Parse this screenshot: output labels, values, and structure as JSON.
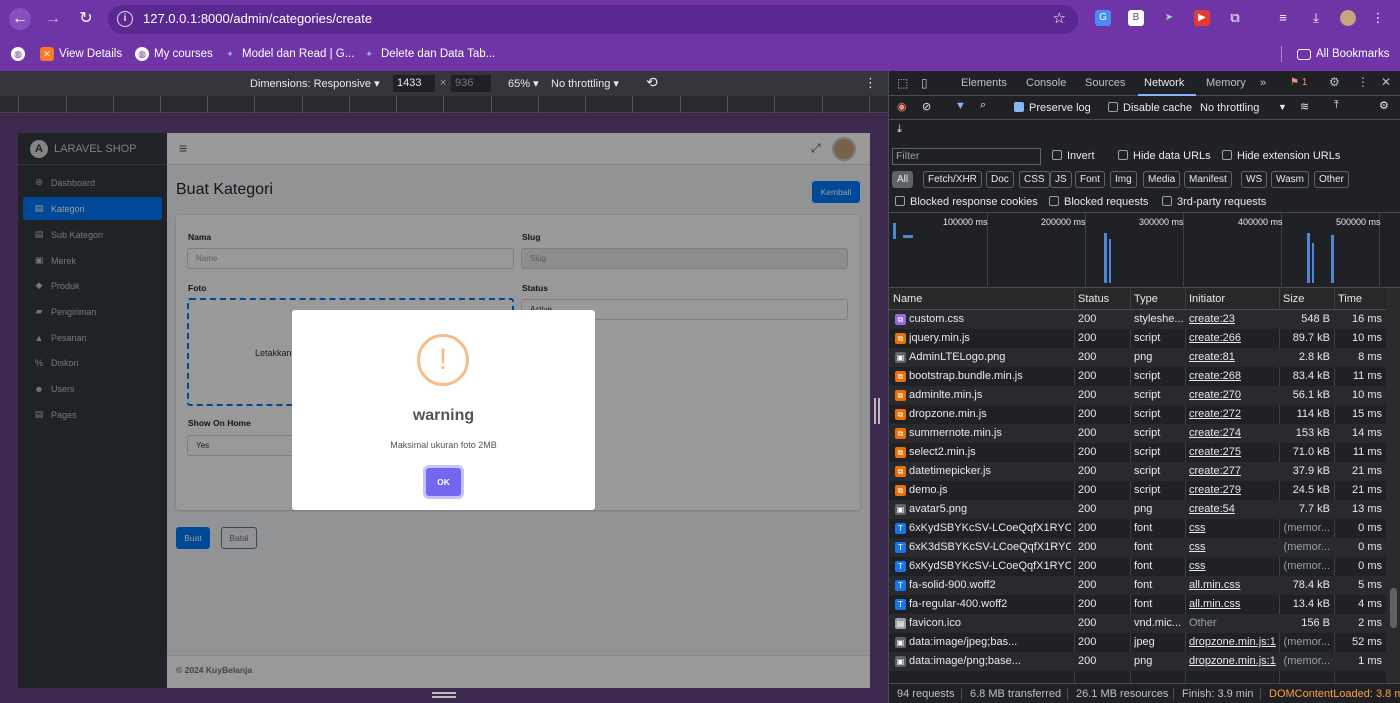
{
  "browser": {
    "url": "127.0.0.1:8000/admin/categories/create",
    "bookmarks": [
      {
        "label": "View Details",
        "icon": "xampp-icon"
      },
      {
        "label": "My courses",
        "icon": "globe-icon"
      },
      {
        "label": "Model dan Read | G...",
        "icon": "gemini-icon"
      },
      {
        "label": "Delete dan Data Tab...",
        "icon": "gemini-icon"
      }
    ],
    "all_bookmarks": "All Bookmarks"
  },
  "emulation": {
    "dimensions": "Dimensions: Responsive ▾",
    "width": "1433",
    "times": "×",
    "height": "936",
    "zoom": "65% ▾",
    "throttle": "No throttling ▾"
  },
  "app": {
    "brand": "LARAVEL SHOP",
    "brand_initial": "A",
    "nav": [
      {
        "label": "Dashboard",
        "icon": "⊛"
      },
      {
        "label": "Kategori",
        "icon": "▤"
      },
      {
        "label": "Sub Kategori",
        "icon": "▤"
      },
      {
        "label": "Merek",
        "icon": "▣"
      },
      {
        "label": "Produk",
        "icon": "◆"
      },
      {
        "label": "Pengiriman",
        "icon": "▰"
      },
      {
        "label": "Pesanan",
        "icon": "▲"
      },
      {
        "label": "Diskon",
        "icon": "%"
      },
      {
        "label": "Users",
        "icon": "☻"
      },
      {
        "label": "Pages",
        "icon": "▤"
      }
    ],
    "menu_icon": "≡",
    "expand_icon": "⤢",
    "page_title": "Buat Kategori",
    "back_button": "Kembali",
    "form": {
      "name_label": "Nama",
      "name_placeholder": "Name",
      "slug_label": "Slug",
      "slug_placeholder": "Slug",
      "photo_label": "Foto",
      "dropzone_text": "Letakkan",
      "status_label": "Status",
      "status_value": "Active",
      "show_home_label": "Show On Home",
      "show_home_value": "Yes"
    },
    "submit": "Buat",
    "cancel": "Batal",
    "footer": "© 2024 KuyBelanja"
  },
  "modal": {
    "icon": "!",
    "title": "warning",
    "message": "Maksimal ukuran foto 2MB",
    "ok": "OK"
  },
  "devtools": {
    "tabs": [
      "Elements",
      "Console",
      "Sources",
      "Network",
      "Memory",
      "»"
    ],
    "active_tab": "Network",
    "issues": "1",
    "preserve_log": "Preserve log",
    "disable_cache": "Disable cache",
    "throttling": "No throttling",
    "filter_placeholder": "Filter",
    "invert": "Invert",
    "hide_data_urls": "Hide data URLs",
    "hide_ext_urls": "Hide extension URLs",
    "chips": [
      "All",
      "Fetch/XHR",
      "Doc",
      "CSS",
      "JS",
      "Font",
      "Img",
      "Media",
      "Manifest",
      "WS",
      "Wasm",
      "Other"
    ],
    "blocked_cookies": "Blocked response cookies",
    "blocked_requests": "Blocked requests",
    "third_party": "3rd-party requests",
    "timeline_labels": [
      "100000 ms",
      "200000 ms",
      "300000 ms",
      "400000 ms",
      "500000 ms"
    ],
    "columns": [
      "Name",
      "Status",
      "Type",
      "Initiator",
      "Size",
      "Time"
    ],
    "rows": [
      {
        "name": "custom.css",
        "status": "200",
        "type": "styleshe...",
        "initiator": "create:23",
        "size": "548 B",
        "time": "16 ms",
        "icon": "css"
      },
      {
        "name": "jquery.min.js",
        "status": "200",
        "type": "script",
        "initiator": "create:266",
        "size": "89.7 kB",
        "time": "10 ms",
        "icon": "js"
      },
      {
        "name": "AdminLTELogo.png",
        "status": "200",
        "type": "png",
        "initiator": "create:81",
        "size": "2.8 kB",
        "time": "8 ms",
        "icon": "img"
      },
      {
        "name": "bootstrap.bundle.min.js",
        "status": "200",
        "type": "script",
        "initiator": "create:268",
        "size": "83.4 kB",
        "time": "11 ms",
        "icon": "js"
      },
      {
        "name": "adminlte.min.js",
        "status": "200",
        "type": "script",
        "initiator": "create:270",
        "size": "56.1 kB",
        "time": "10 ms",
        "icon": "js"
      },
      {
        "name": "dropzone.min.js",
        "status": "200",
        "type": "script",
        "initiator": "create:272",
        "size": "114 kB",
        "time": "15 ms",
        "icon": "js"
      },
      {
        "name": "summernote.min.js",
        "status": "200",
        "type": "script",
        "initiator": "create:274",
        "size": "153 kB",
        "time": "14 ms",
        "icon": "js"
      },
      {
        "name": "select2.min.js",
        "status": "200",
        "type": "script",
        "initiator": "create:275",
        "size": "71.0 kB",
        "time": "11 ms",
        "icon": "js"
      },
      {
        "name": "datetimepicker.js",
        "status": "200",
        "type": "script",
        "initiator": "create:277",
        "size": "37.9 kB",
        "time": "21 ms",
        "icon": "js"
      },
      {
        "name": "demo.js",
        "status": "200",
        "type": "script",
        "initiator": "create:279",
        "size": "24.5 kB",
        "time": "21 ms",
        "icon": "js"
      },
      {
        "name": "avatar5.png",
        "status": "200",
        "type": "png",
        "initiator": "create:54",
        "size": "7.7 kB",
        "time": "13 ms",
        "icon": "img"
      },
      {
        "name": "6xKydSBYKcSV-LCoeQqfX1RYO...",
        "status": "200",
        "type": "font",
        "initiator": "css",
        "size": "(memor...",
        "time": "0 ms",
        "icon": "font"
      },
      {
        "name": "6xK3dSBYKcSV-LCoeQqfX1RYO...",
        "status": "200",
        "type": "font",
        "initiator": "css",
        "size": "(memor...",
        "time": "0 ms",
        "icon": "font"
      },
      {
        "name": "6xKydSBYKcSV-LCoeQqfX1RYO...",
        "status": "200",
        "type": "font",
        "initiator": "css",
        "size": "(memor...",
        "time": "0 ms",
        "icon": "font"
      },
      {
        "name": "fa-solid-900.woff2",
        "status": "200",
        "type": "font",
        "initiator": "all.min.css",
        "size": "78.4 kB",
        "time": "5 ms",
        "icon": "font"
      },
      {
        "name": "fa-regular-400.woff2",
        "status": "200",
        "type": "font",
        "initiator": "all.min.css",
        "size": "13.4 kB",
        "time": "4 ms",
        "icon": "font"
      },
      {
        "name": "favicon.ico",
        "status": "200",
        "type": "vnd.mic...",
        "initiator": "Other",
        "size": "156 B",
        "time": "2 ms",
        "icon": "doc"
      },
      {
        "name": "data:image/jpeg;bas...",
        "status": "200",
        "type": "jpeg",
        "initiator": "dropzone.min.js:1",
        "size": "(memor...",
        "time": "52 ms",
        "icon": "img"
      },
      {
        "name": "data:image/png;base...",
        "status": "200",
        "type": "png",
        "initiator": "dropzone.min.js:1",
        "size": "(memor...",
        "time": "1 ms",
        "icon": "img"
      }
    ],
    "summary": {
      "requests": "94 requests",
      "transferred": "6.8 MB transferred",
      "resources": "26.1 MB resources",
      "finish": "Finish: 3.9 min",
      "dcl": "DOMContentLoaded: 3.8 m"
    },
    "colors": {
      "accent": "#8ab4f8",
      "dcl": "#ff9f43"
    }
  }
}
